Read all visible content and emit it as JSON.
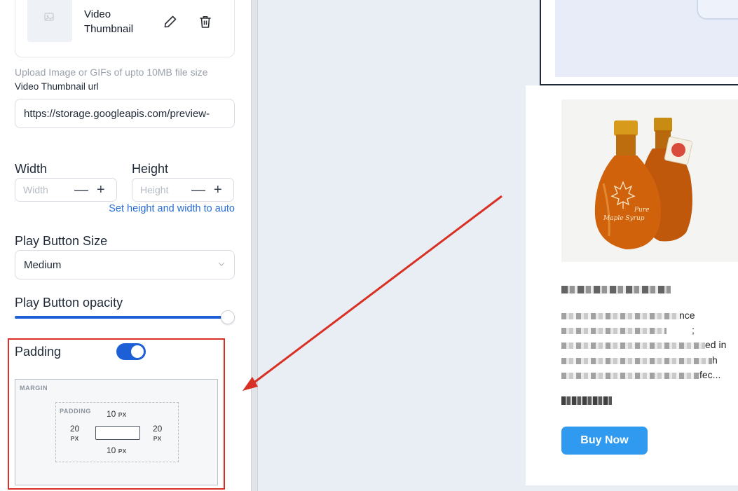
{
  "thumbnail": {
    "title": "Video Thumbnail",
    "edit_icon": "pencil-icon",
    "delete_icon": "trash-icon",
    "placeholder_icon": "image-icon"
  },
  "upload_helper": "Upload Image or GIFs of upto 10MB file size",
  "video_thumbnail_url": {
    "label": "Video Thumbnail url",
    "value": "https://storage.googleapis.com/preview-"
  },
  "dimensions": {
    "width_label": "Width",
    "width_placeholder": "Width",
    "height_label": "Height",
    "height_placeholder": "Height",
    "minus": "—",
    "plus": "+",
    "auto_link": "Set height and width to auto"
  },
  "play_button_size": {
    "label": "Play Button Size",
    "selected": "Medium"
  },
  "play_button_opacity": {
    "label": "Play Button opacity",
    "value_fraction": 1.0
  },
  "padding": {
    "label": "Padding",
    "enabled": true,
    "margin_label": "MARGIN",
    "padding_label": "PADDING",
    "top": "10",
    "bottom": "10",
    "left": "20",
    "right": "20",
    "unit": "PX"
  },
  "preview": {
    "description_tails": [
      "nce",
      ";",
      "ed in",
      "h",
      "fec..."
    ],
    "buy_button": "Buy Now",
    "product_image_text": [
      "Pure",
      "Maple Syrup"
    ]
  },
  "colors": {
    "accent": "#1d5fd6",
    "link": "#2a6ed8",
    "highlight": "#d93025",
    "buy_button": "#2f9af0"
  }
}
